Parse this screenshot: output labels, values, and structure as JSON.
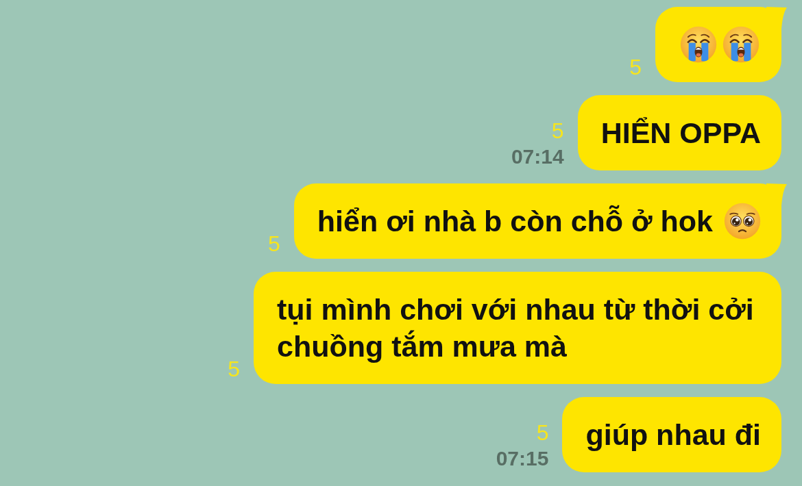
{
  "messages": [
    {
      "emojis": [
        {
          "kind": "crying"
        },
        {
          "kind": "crying"
        }
      ],
      "unread": "5",
      "tail": true
    },
    {
      "text": "HIỂN OPPA",
      "unread": "5",
      "time": "07:14",
      "tail": false
    },
    {
      "text": "hiển ơi nhà b còn chỗ ở hok",
      "emojis": [
        {
          "kind": "pleading"
        }
      ],
      "unread": "5",
      "tail": true
    },
    {
      "text": "tụi mình chơi với nhau từ thời cởi chuồng tắm mưa mà",
      "unread": "5",
      "tail": false
    },
    {
      "text": "giúp nhau đi",
      "unread": "5",
      "time": "07:15",
      "tail": false
    }
  ]
}
